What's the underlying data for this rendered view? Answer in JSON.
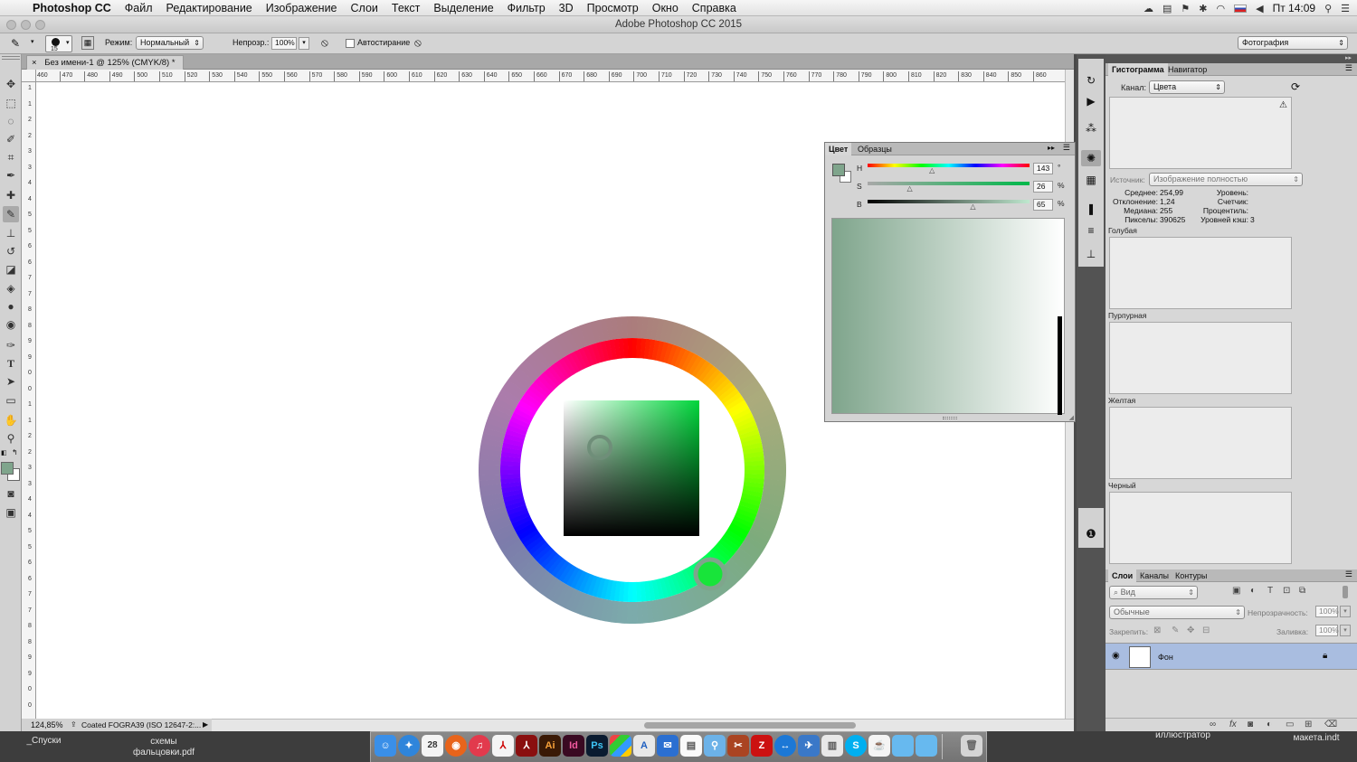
{
  "menubar": {
    "app_name": "Photoshop CC",
    "items": [
      "Файл",
      "Редактирование",
      "Изображение",
      "Слои",
      "Текст",
      "Выделение",
      "Фильтр",
      "3D",
      "Просмотр",
      "Окно",
      "Справка"
    ],
    "clock": "Пт 14:09"
  },
  "window": {
    "title": "Adobe Photoshop CC 2015"
  },
  "options": {
    "brush_size": "15",
    "mode_label": "Режим:",
    "mode_value": "Нормальный",
    "opacity_label": "Непрозр.:",
    "opacity_value": "100%",
    "airbrush_label": "Автостирание",
    "workspace": "Фотография"
  },
  "document": {
    "tab_title": "Без имени-1 @ 125% (CMYK/8) *",
    "zoom": "124,85%",
    "profile": "Coated FOGRA39 (ISO 12647-2:..."
  },
  "ruler": {
    "h_ticks": [
      "460",
      "470",
      "480",
      "490",
      "500",
      "510",
      "520",
      "530",
      "540",
      "550",
      "560",
      "570",
      "580",
      "590",
      "600",
      "610",
      "620",
      "630",
      "640",
      "650",
      "660",
      "670",
      "680",
      "690",
      "700",
      "710",
      "720",
      "730",
      "740",
      "750",
      "760",
      "770",
      "780",
      "790",
      "800",
      "810",
      "820",
      "830",
      "840",
      "850",
      "860"
    ],
    "v_ticks": [
      "1",
      "1",
      "2",
      "2",
      "3",
      "3",
      "4",
      "4",
      "5",
      "5",
      "6",
      "6",
      "7",
      "7",
      "8",
      "8",
      "9",
      "9",
      "0",
      "0",
      "1",
      "1",
      "2",
      "2",
      "3",
      "3",
      "4",
      "4",
      "5",
      "5",
      "6",
      "6",
      "7",
      "7",
      "8",
      "8",
      "9",
      "9",
      "0",
      "0"
    ]
  },
  "color_panel": {
    "tabs": [
      "Цвет",
      "Образцы"
    ],
    "h_label": "H",
    "h_value": "143",
    "h_unit": "°",
    "s_label": "S",
    "s_value": "26",
    "s_unit": "%",
    "b_label": "B",
    "b_value": "65",
    "b_unit": "%",
    "h": 143,
    "s": 26,
    "b": 65,
    "foreground": "#7fa58c"
  },
  "histogram_panel": {
    "tabs": [
      "Гистограмма",
      "Навигатор"
    ],
    "channel_label": "Канал:",
    "channel_value": "Цвета",
    "source_label": "Источник:",
    "source_value": "Изображение полностью",
    "stats_left": [
      {
        "k": "Среднее:",
        "v": "254,99"
      },
      {
        "k": "Отклонение:",
        "v": "1,24"
      },
      {
        "k": "Медиана:",
        "v": "255"
      },
      {
        "k": "Пикселы:",
        "v": "390625"
      }
    ],
    "stats_right": [
      {
        "k": "Уровень:",
        "v": ""
      },
      {
        "k": "Счетчик:",
        "v": ""
      },
      {
        "k": "Процентиль:",
        "v": ""
      },
      {
        "k": "Уровней кэш:",
        "v": "3"
      }
    ],
    "channels": [
      "Голубая",
      "Пурпурная",
      "Желтая",
      "Черный"
    ]
  },
  "layers_panel": {
    "tabs": [
      "Слои",
      "Каналы",
      "Контуры"
    ],
    "filter_placeholder": "Вид",
    "blend_mode": "Обычные",
    "opacity_label": "Непрозрачность:",
    "opacity_value": "100%",
    "lock_label": "Закрепить:",
    "fill_label": "Заливка:",
    "fill_value": "100%",
    "layer_name": "Фон"
  },
  "desktop": {
    "left_items": [
      "_Спуски",
      "схемы фальцовки.pdf"
    ],
    "right_items": [
      "иллюстратор",
      "макета.indt"
    ]
  },
  "dock_apps": [
    "Finder",
    "Safari",
    "Календарь 28",
    "Firefox",
    "iTunes",
    "Acrobat",
    "Acrobat Pro",
    "Ai",
    "Id",
    "Ps",
    "Мозаика",
    "Font",
    "Mail",
    "Заметки",
    "Поиск",
    "Инструменты",
    "FileZilla",
    "TeamViewer",
    "Почта",
    "Статистика",
    "Skype",
    "Java",
    "Папка",
    "Папка",
    "Корзина"
  ]
}
